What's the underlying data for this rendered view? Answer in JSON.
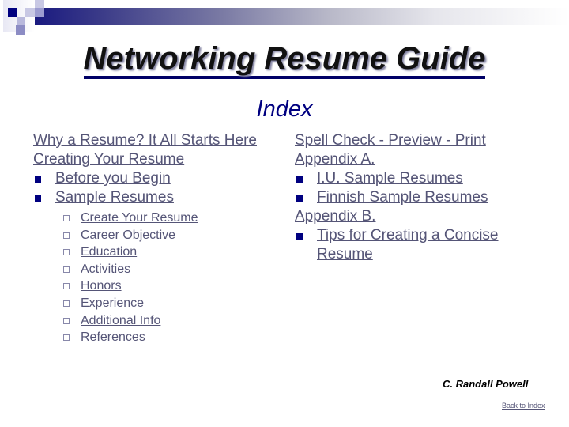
{
  "header": {
    "title": "Networking Resume Guide",
    "subtitle": "Index"
  },
  "left_column": {
    "items": [
      {
        "label": "Why a Resume? It All Starts Here",
        "level": 0
      },
      {
        "label": "Creating Your Resume",
        "level": 0
      },
      {
        "label": "Before you Begin",
        "level": 1
      },
      {
        "label": "Sample Resumes",
        "level": 1
      }
    ],
    "sub_items": [
      "Create Your Resume",
      "Career Objective",
      "Education",
      "Activities",
      "Honors",
      "Experience",
      "Additional Info",
      "References"
    ]
  },
  "right_column": {
    "items": [
      {
        "label": "Spell Check - Preview - Print",
        "level": 0
      },
      {
        "label": "Appendix A.",
        "level": 0
      },
      {
        "label": "I.U. Sample Resumes",
        "level": 1
      },
      {
        "label": "Finnish Sample Resumes",
        "level": 1
      },
      {
        "label": "Appendix B.",
        "level": 0
      },
      {
        "label": "Tips for Creating a Concise Resume",
        "level": 1
      }
    ]
  },
  "footer": {
    "author": "C. Randall Powell",
    "back_link": "Back to Index"
  },
  "colors": {
    "accent": "#000080",
    "link": "#555577"
  }
}
